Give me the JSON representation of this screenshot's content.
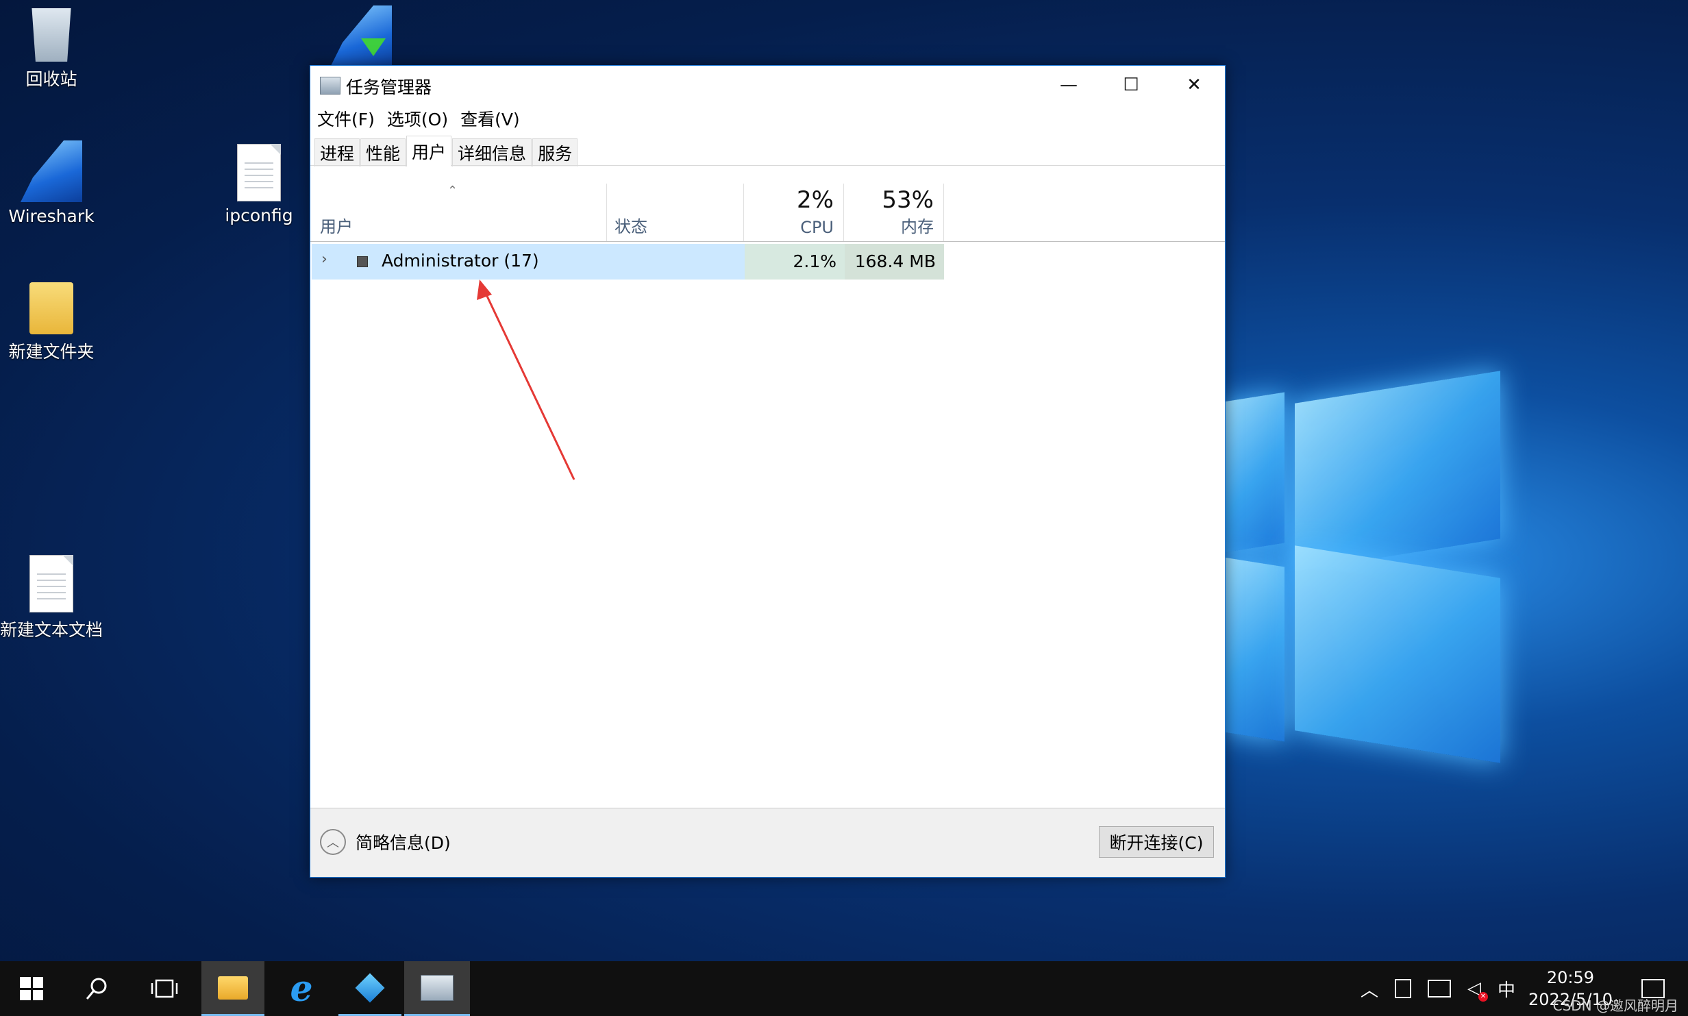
{
  "desktop": {
    "icons": [
      {
        "label": "回收站"
      },
      {
        "label": "Wireshark"
      },
      {
        "label": "ipconfig"
      },
      {
        "label": "新建文件夹"
      },
      {
        "label": "新建文本文档"
      }
    ]
  },
  "window": {
    "title": "任务管理器",
    "controls": {
      "minimize": "—",
      "maximize": "☐",
      "close": "✕"
    },
    "menu": [
      "文件(F)",
      "选项(O)",
      "查看(V)"
    ],
    "tabs": [
      "进程",
      "性能",
      "用户",
      "详细信息",
      "服务"
    ],
    "active_tab": "用户",
    "columns": {
      "user": "用户",
      "status": "状态",
      "cpu_pct": "2%",
      "cpu_label": "CPU",
      "mem_pct": "53%",
      "mem_label": "内存"
    },
    "rows": [
      {
        "name": "Administrator (17)",
        "status": "",
        "cpu": "2.1%",
        "memory": "168.4 MB"
      }
    ],
    "footer": {
      "less_details": "简略信息(D)",
      "disconnect": "断开连接(C)"
    }
  },
  "annotation": {
    "arrow_color": "#e53935"
  },
  "taskbar": {
    "tray_lang": "中",
    "time": "20:59",
    "date": "2022/5/10",
    "watermark": "CSDN @邀风醉明月"
  }
}
